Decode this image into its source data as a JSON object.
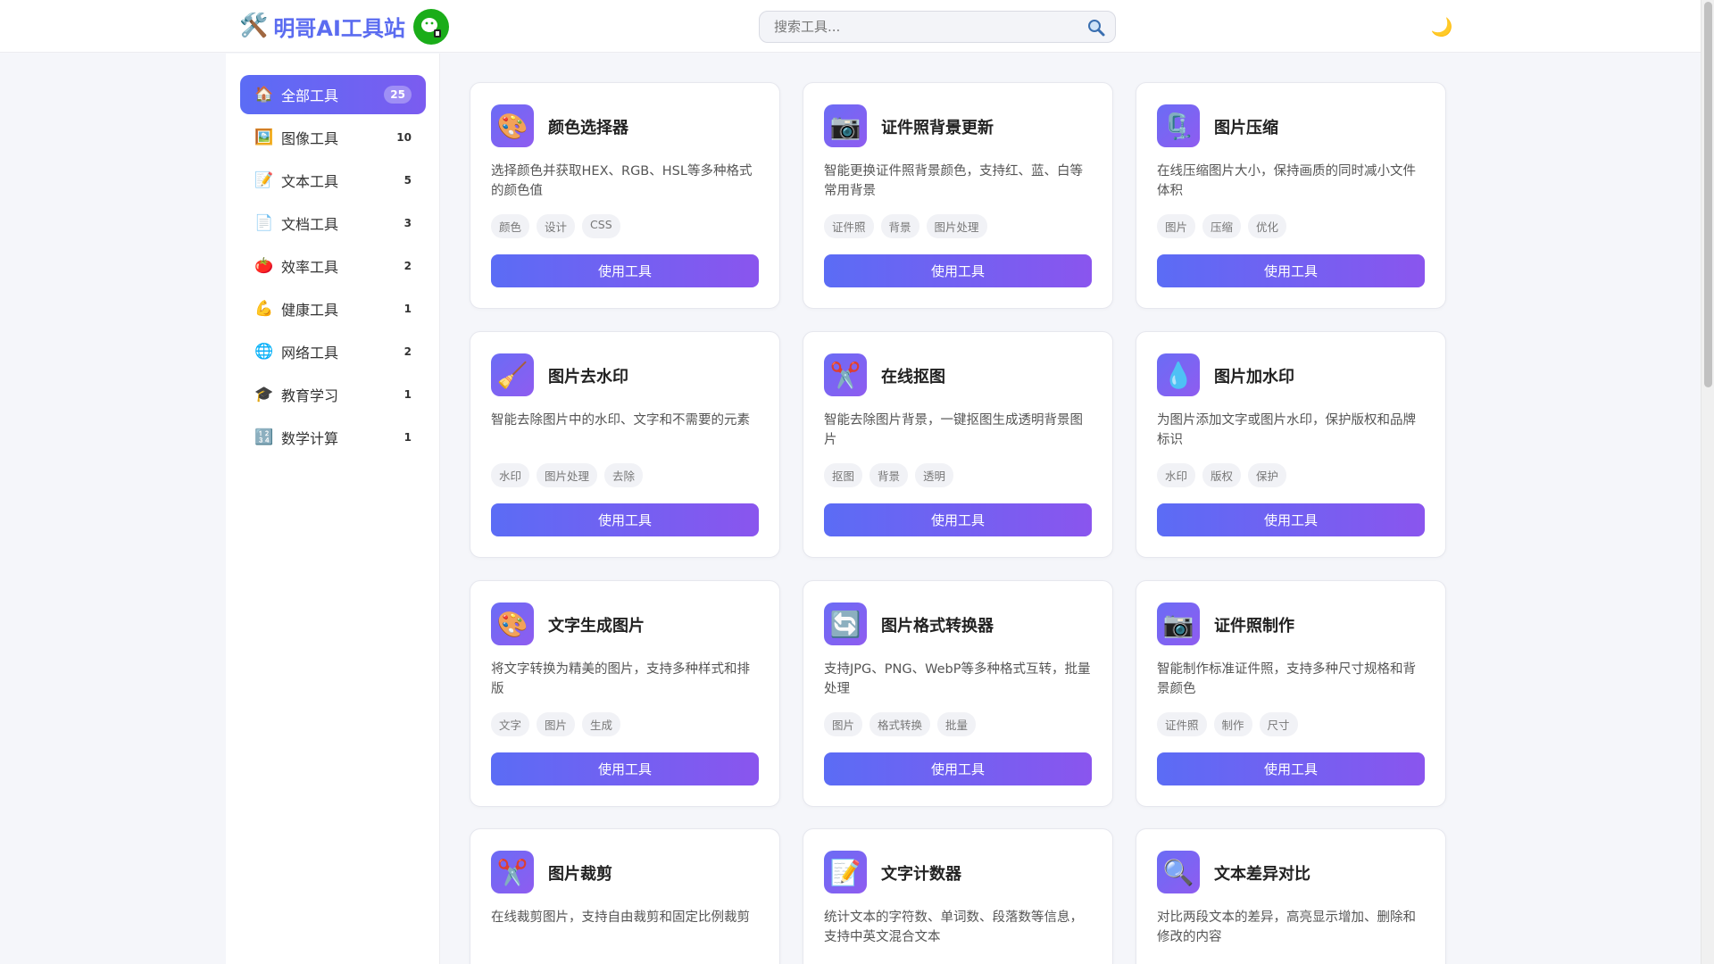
{
  "header": {
    "logo_icon": "🛠️",
    "title": "明哥AI工具站",
    "search_placeholder": "搜索工具...",
    "theme_icon": "🌙"
  },
  "sidebar": {
    "items": [
      {
        "icon": "🏠",
        "label": "全部工具",
        "count": "25",
        "active": true
      },
      {
        "icon": "🖼️",
        "label": "图像工具",
        "count": "10"
      },
      {
        "icon": "📝",
        "label": "文本工具",
        "count": "5"
      },
      {
        "icon": "📄",
        "label": "文档工具",
        "count": "3"
      },
      {
        "icon": "🍅",
        "label": "效率工具",
        "count": "2"
      },
      {
        "icon": "💪",
        "label": "健康工具",
        "count": "1"
      },
      {
        "icon": "🌐",
        "label": "网络工具",
        "count": "2"
      },
      {
        "icon": "🎓",
        "label": "教育学习",
        "count": "1"
      },
      {
        "icon": "🔢",
        "label": "数学计算",
        "count": "1"
      }
    ]
  },
  "cards": [
    {
      "icon": "🎨",
      "title": "颜色选择器",
      "desc": "选择颜色并获取HEX、RGB、HSL等多种格式的颜色值",
      "tags": [
        "颜色",
        "设计",
        "CSS"
      ],
      "button": "使用工具"
    },
    {
      "icon": "📷",
      "title": "证件照背景更新",
      "desc": "智能更换证件照背景颜色，支持红、蓝、白等常用背景",
      "tags": [
        "证件照",
        "背景",
        "图片处理"
      ],
      "button": "使用工具"
    },
    {
      "icon": "🗜️",
      "title": "图片压缩",
      "desc": "在线压缩图片大小，保持画质的同时减小文件体积",
      "tags": [
        "图片",
        "压缩",
        "优化"
      ],
      "button": "使用工具"
    },
    {
      "icon": "🧹",
      "title": "图片去水印",
      "desc": "智能去除图片中的水印、文字和不需要的元素",
      "tags": [
        "水印",
        "图片处理",
        "去除"
      ],
      "button": "使用工具"
    },
    {
      "icon": "✂️",
      "title": "在线抠图",
      "desc": "智能去除图片背景，一键抠图生成透明背景图片",
      "tags": [
        "抠图",
        "背景",
        "透明"
      ],
      "button": "使用工具"
    },
    {
      "icon": "💧",
      "title": "图片加水印",
      "desc": "为图片添加文字或图片水印，保护版权和品牌标识",
      "tags": [
        "水印",
        "版权",
        "保护"
      ],
      "button": "使用工具"
    },
    {
      "icon": "🎨",
      "title": "文字生成图片",
      "desc": "将文字转换为精美的图片，支持多种样式和排版",
      "tags": [
        "文字",
        "图片",
        "生成"
      ],
      "button": "使用工具"
    },
    {
      "icon": "🔄",
      "title": "图片格式转换器",
      "desc": "支持JPG、PNG、WebP等多种格式互转，批量处理",
      "tags": [
        "图片",
        "格式转换",
        "批量"
      ],
      "button": "使用工具"
    },
    {
      "icon": "📷",
      "title": "证件照制作",
      "desc": "智能制作标准证件照，支持多种尺寸规格和背景颜色",
      "tags": [
        "证件照",
        "制作",
        "尺寸"
      ],
      "button": "使用工具"
    },
    {
      "icon": "✂️",
      "title": "图片裁剪",
      "desc": "在线裁剪图片，支持自由裁剪和固定比例裁剪",
      "tags": [],
      "button": ""
    },
    {
      "icon": "📝",
      "title": "文字计数器",
      "desc": "统计文本的字符数、单词数、段落数等信息，支持中英文混合文本",
      "tags": [],
      "button": ""
    },
    {
      "icon": "🔍",
      "title": "文本差异对比",
      "desc": "对比两段文本的差异，高亮显示增加、删除和修改的内容",
      "tags": [],
      "button": ""
    }
  ]
}
